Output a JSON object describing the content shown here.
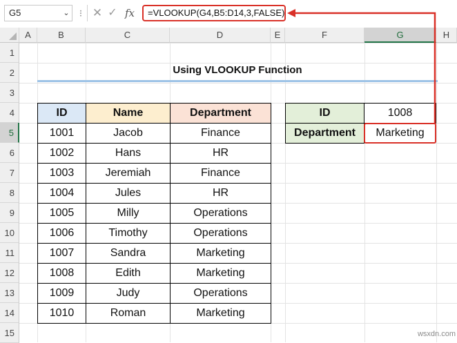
{
  "formula_bar": {
    "name_box": "G5",
    "formula": "=VLOOKUP(G4,B5:D14,3,FALSE)",
    "fx_label": "fx",
    "dots": "⁝",
    "cancel_glyph": "✕",
    "enter_glyph": "✓"
  },
  "columns": [
    "A",
    "B",
    "C",
    "D",
    "E",
    "F",
    "G",
    "H"
  ],
  "selected_column": "G",
  "rows": [
    "1",
    "2",
    "3",
    "4",
    "5",
    "6",
    "7",
    "8",
    "9",
    "10",
    "11",
    "12",
    "13",
    "14",
    "15"
  ],
  "selected_row": "5",
  "title": "Using VLOOKUP Function",
  "data_table": {
    "headers": [
      "ID",
      "Name",
      "Department"
    ],
    "rows": [
      [
        "1001",
        "Jacob",
        "Finance"
      ],
      [
        "1002",
        "Hans",
        "HR"
      ],
      [
        "1003",
        "Jeremiah",
        "Finance"
      ],
      [
        "1004",
        "Jules",
        "HR"
      ],
      [
        "1005",
        "Milly",
        "Operations"
      ],
      [
        "1006",
        "Timothy",
        "Operations"
      ],
      [
        "1007",
        "Sandra",
        "Marketing"
      ],
      [
        "1008",
        "Edith",
        "Marketing"
      ],
      [
        "1009",
        "Judy",
        "Operations"
      ],
      [
        "1010",
        "Roman",
        "Marketing"
      ]
    ]
  },
  "lookup_table": {
    "id_label": "ID",
    "id_value": "1008",
    "dept_label": "Department",
    "dept_value": "Marketing"
  },
  "colors": {
    "id_header": "#dbe8f6",
    "name_header": "#fdeecf",
    "dept_header": "#fbe2d6",
    "lookup_label": "#e3efd9",
    "highlight": "#d93027",
    "excel_green": "#217346"
  },
  "watermark": "wsxdn.com"
}
